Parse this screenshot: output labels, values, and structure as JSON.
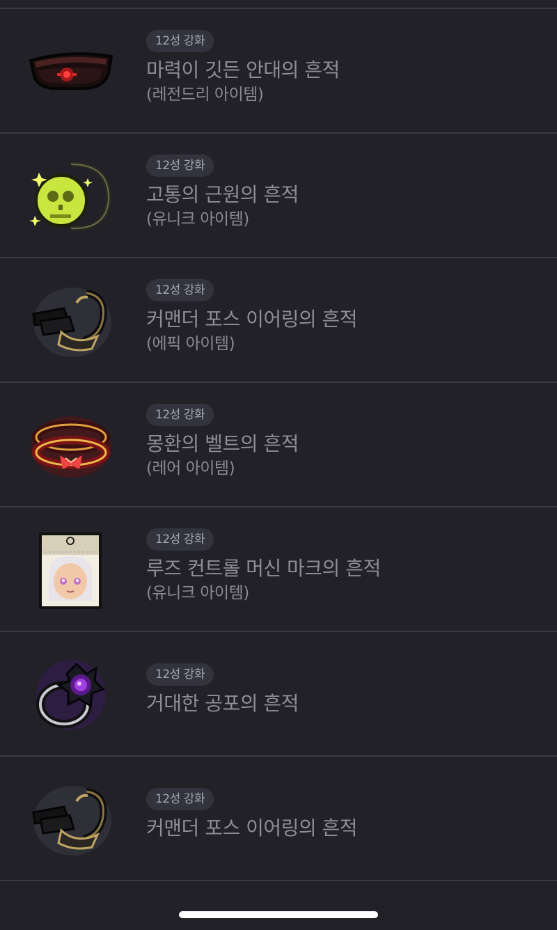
{
  "items": [
    {
      "badge": "12성 강화",
      "name": "마력이 깃든 안대의 흔적",
      "grade": "(레전드리 아이템)",
      "icon": "eyepatch-icon"
    },
    {
      "badge": "12성 강화",
      "name": "고통의 근원의 흔적",
      "grade": "(유니크 아이템)",
      "icon": "skull-pendant-icon"
    },
    {
      "badge": "12성 강화",
      "name": "커맨더 포스 이어링의 흔적",
      "grade": "(에픽 아이템)",
      "icon": "earring-icon"
    },
    {
      "badge": "12성 강화",
      "name": "몽환의 벨트의 흔적",
      "grade": "(레어 아이템)",
      "icon": "belt-icon"
    },
    {
      "badge": "12성 강화",
      "name": "루즈 컨트롤 머신 마크의 흔적",
      "grade": "(유니크 아이템)",
      "icon": "machine-mark-icon"
    },
    {
      "badge": "12성 강화",
      "name": "거대한 공포의 흔적",
      "icon": "ring-icon"
    },
    {
      "badge": "12성 강화",
      "name": "커맨더 포스 이어링의 흔적",
      "icon": "earring-icon"
    }
  ],
  "colors": {
    "background": "#212127",
    "divider": "#3a3a42",
    "badge_background": "#32333d",
    "text": "#8e8e94"
  }
}
